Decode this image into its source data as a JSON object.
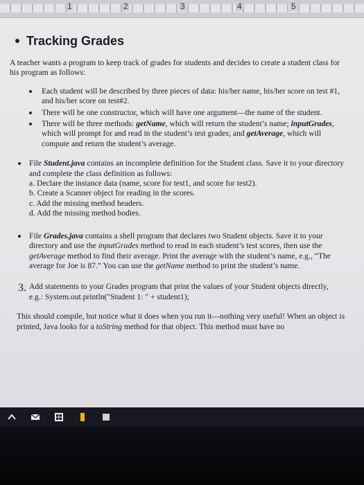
{
  "ruler": {
    "marks": [
      "1",
      "2",
      "3",
      "4",
      "5"
    ]
  },
  "document": {
    "heading": "Tracking Grades",
    "intro": "A teacher wants a program to keep track of grades for students and decides to create a student class for his program as follows:",
    "bullets": [
      "Each student will be described by three pieces of data: his/her name, his/her score on test #1, and his/her score on test#2.",
      "There will be one constructor, which will have one argument—the name of the student.",
      {
        "pre": "There will be three methods: ",
        "m1": "getName",
        "mid1": ", which will return the student’s name; ",
        "m2": "inputGrades",
        "mid2": ", which will prompt for and read in the student’s test grades; and ",
        "m3": "getAverage",
        "post": ", which will compute and return the student’s average."
      }
    ],
    "student_file": {
      "pre": "File ",
      "file": "Student.java",
      "post": " contains an incomplete definition for the Student class. Save it to your directory and complete the class definition as follows:",
      "steps": [
        "a. Declare the instance data (name, score for test1, and score for test2).",
        "b. Create a Scanner object for reading in the scores.",
        "c. Add the missing method headers.",
        "d. Add the missing method bodies."
      ]
    },
    "grades_file": {
      "pre": "File ",
      "file": "Grades.java",
      "mid1": " contains a shell program that declares two Student objects. Save it to your directory and use the ",
      "m1": "inputGrades",
      "mid2": " method to read in each student’s test scores, then use the ",
      "m2": "getAverage",
      "mid3": " method to find their average. Print the average with the student’s name, e.g., “The average for Joe is 87.” You can use the ",
      "m3": "getName",
      "post": " method to print the student’s name."
    },
    "step3": {
      "number": "3.",
      "text": "Add statements to your Grades program that print the values of your Student objects directly, e.g.: System.out.println(\"Student 1: \" + student1);"
    },
    "closing": {
      "pre": "This should compile, but notice what it does when you run it—nothing very useful! When an object is printed, Java looks for a ",
      "m1": "toString",
      "post": " method for that object. This method must have no"
    }
  },
  "taskbar": {
    "icons": [
      "start-arrow-icon",
      "mail-icon",
      "store-icon",
      "bookmark-icon",
      "grid-app-icon"
    ],
    "colors": {
      "background": "#171821",
      "accent": "#f2b400"
    }
  }
}
